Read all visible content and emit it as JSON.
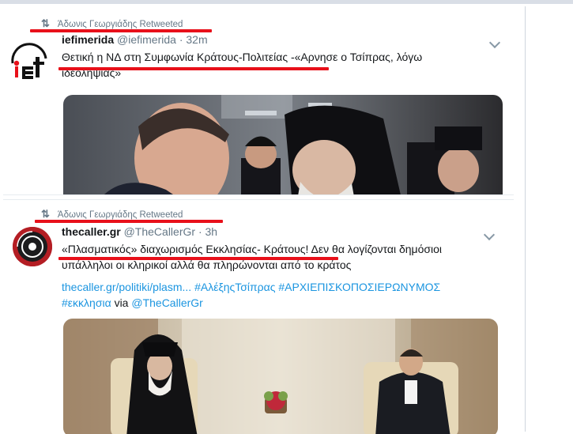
{
  "tweets": [
    {
      "retweeted_by": "Άδωνις Γεωργιάδης Retweeted",
      "name": "iefimerida",
      "handle": "@iefimerida",
      "separator": "·",
      "time": "32m",
      "text_line1": "Θετική η ΝΔ στη Συμφωνία Κράτους-Πολιτείας -«Αρνησε ο Τσίπρας, λόγω",
      "text_line2": "ιδεοληψίας»",
      "avatar_text": "iet",
      "icon": "retweet-icon"
    },
    {
      "retweeted_by": "Άδωνις Γεωργιάδης Retweeted",
      "name": "thecaller.gr",
      "handle": "@TheCallerGr",
      "separator": "·",
      "time": "3h",
      "text_line1": "«Πλασματικός» διαχωρισμός Εκκλησίας- Κράτους! Δεν θα λογίζονται δημόσιοι",
      "text_line2": "υπάλληλοι οι κληρικοί αλλά θα πληρώνονται από το κράτος",
      "link": "thecaller.gr/politiki/plasm...",
      "hashtag1": "#ΑλέξηςΤσίπρας",
      "hashtag2": "#ΑΡΧΙΕΠΙΣΚΟΠΟΣΙΕΡΩΝΥΜΟΣ",
      "hashtag3": "#εκκλησια",
      "via": "via",
      "via_handle": "@TheCallerGr",
      "icon": "retweet-icon"
    }
  ],
  "colors": {
    "link": "#1b95e0",
    "underline": "#e8101a",
    "muted": "#657786"
  }
}
